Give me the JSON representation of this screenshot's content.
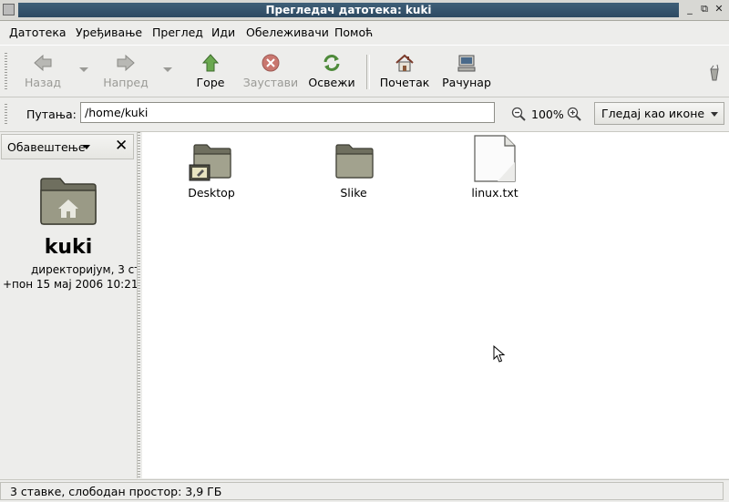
{
  "window": {
    "title": "Прегледач датотека: kuki"
  },
  "menubar": {
    "items": [
      "Датотека",
      "Уређивање",
      "Преглед",
      "Иди",
      "Обележивачи",
      "Помоћ"
    ]
  },
  "toolbar": {
    "back": "Назад",
    "forward": "Напред",
    "up": "Горе",
    "stop": "Заустави",
    "reload": "Освежи",
    "home": "Почетак",
    "computer": "Рачунар"
  },
  "location": {
    "label": "Путања:",
    "path": "/home/kuki",
    "zoom": "100%",
    "view_mode": "Гледај као иконе"
  },
  "sidebar": {
    "panel_title": "Обавештење",
    "folder_name": "kuki",
    "info_line1": "директоријум, 3 ст",
    "info_line2": "+пон 15 мај 2006 10:21"
  },
  "files": [
    {
      "name": "Desktop",
      "icon": "desktop-folder-icon"
    },
    {
      "name": "Slike",
      "icon": "folder-icon"
    },
    {
      "name": "linux.txt",
      "icon": "text-file-icon"
    }
  ],
  "statusbar": {
    "text": "3 ставке, слободан простор: 3,9 ГБ"
  },
  "colors": {
    "titlebar": "#3f5f78",
    "background": "#ededeb",
    "folder": "#8f8f7a"
  }
}
